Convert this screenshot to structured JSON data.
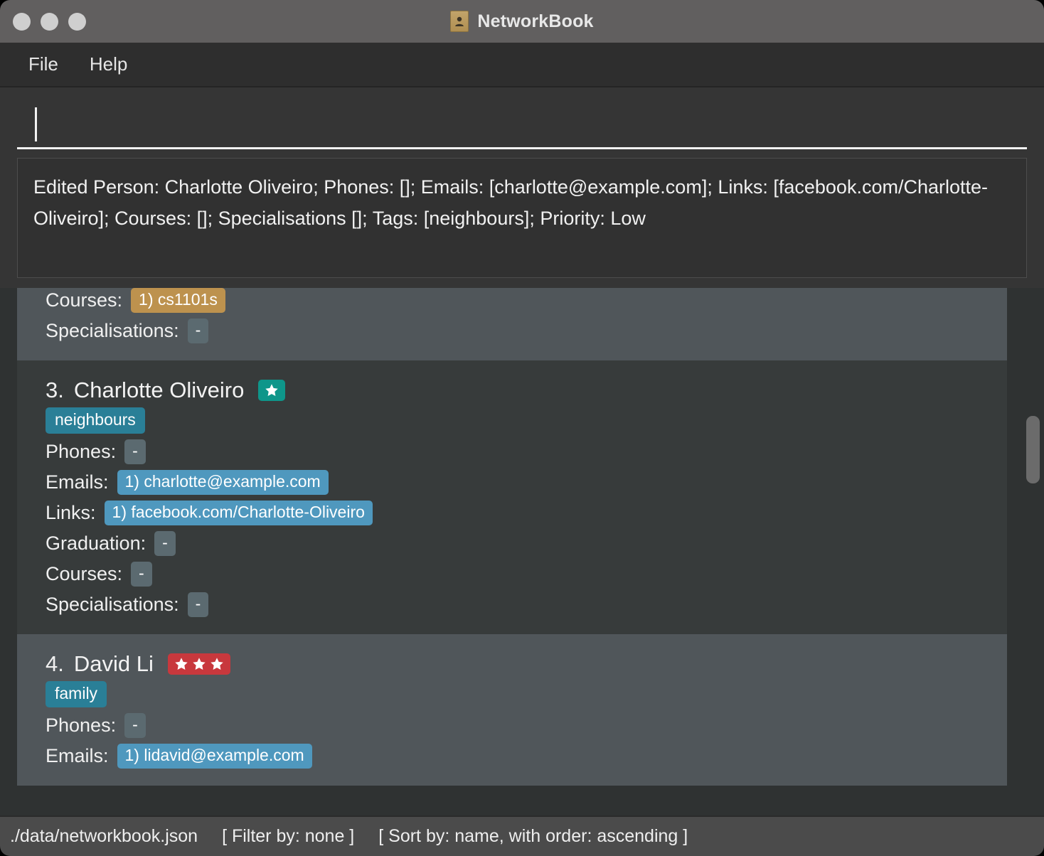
{
  "window": {
    "title": "NetworkBook",
    "app_icon": "address-book-icon",
    "controls": [
      "close-button",
      "minimize-button",
      "maximize-button"
    ]
  },
  "menu": {
    "items": [
      {
        "label": "File",
        "name": "menu-file"
      },
      {
        "label": "Help",
        "name": "menu-help"
      }
    ]
  },
  "command": {
    "value": "",
    "placeholder": ""
  },
  "result": {
    "text": "Edited Person: Charlotte Oliveiro; Phones: []; Emails: [charlotte@example.com]; Links: [facebook.com/Charlotte-Oliveiro]; Courses: []; Specialisations []; Tags: [neighbours]; Priority: Low"
  },
  "person_list": {
    "cards": [
      {
        "clipped": true,
        "index": "",
        "name": "",
        "priority_stars": 0,
        "priority_color": "",
        "tags": [],
        "fields": [
          {
            "label": "Courses:",
            "chips": [
              {
                "text": "1) cs1101s",
                "style": "course"
              }
            ]
          },
          {
            "label": "Specialisations:",
            "chips": [
              {
                "text": "-",
                "style": "empty"
              }
            ]
          }
        ]
      },
      {
        "clipped": false,
        "index": "3.",
        "name": "Charlotte Oliveiro",
        "priority_stars": 1,
        "priority_color": "#0e968a",
        "tags": [
          "neighbours"
        ],
        "fields": [
          {
            "label": "Phones:",
            "chips": [
              {
                "text": "-",
                "style": "empty"
              }
            ]
          },
          {
            "label": "Emails:",
            "chips": [
              {
                "text": "1) charlotte@example.com",
                "style": "value"
              }
            ]
          },
          {
            "label": "Links:",
            "chips": [
              {
                "text": "1) facebook.com/Charlotte-Oliveiro",
                "style": "value"
              }
            ]
          },
          {
            "label": "Graduation:",
            "chips": [
              {
                "text": "-",
                "style": "empty"
              }
            ]
          },
          {
            "label": "Courses:",
            "chips": [
              {
                "text": "-",
                "style": "empty"
              }
            ]
          },
          {
            "label": "Specialisations:",
            "chips": [
              {
                "text": "-",
                "style": "empty"
              }
            ]
          }
        ]
      },
      {
        "clipped": false,
        "index": "4.",
        "name": "David Li",
        "priority_stars": 3,
        "priority_color": "#c8383d",
        "tags": [
          "family"
        ],
        "fields": [
          {
            "label": "Phones:",
            "chips": [
              {
                "text": "-",
                "style": "empty"
              }
            ]
          },
          {
            "label": "Emails:",
            "chips": [
              {
                "text": "1) lidavid@example.com",
                "style": "value"
              }
            ]
          }
        ]
      }
    ]
  },
  "status_bar": {
    "file_path": "./data/networkbook.json",
    "filter": "[ Filter by: none ]",
    "sort": "[ Sort by: name, with order: ascending ]"
  },
  "colors": {
    "title_bar": "#615f5f",
    "menu_bar": "#2e2e2e",
    "card_even": "#50565a",
    "card_odd": "#373b3b",
    "tag": "#2a7f97",
    "chip_value": "#4f98be",
    "chip_course": "#bd924e",
    "chip_empty": "#5b6a70",
    "priority_low": "#0e968a",
    "priority_high": "#c8383d",
    "status_bar": "#4b4b4b"
  }
}
